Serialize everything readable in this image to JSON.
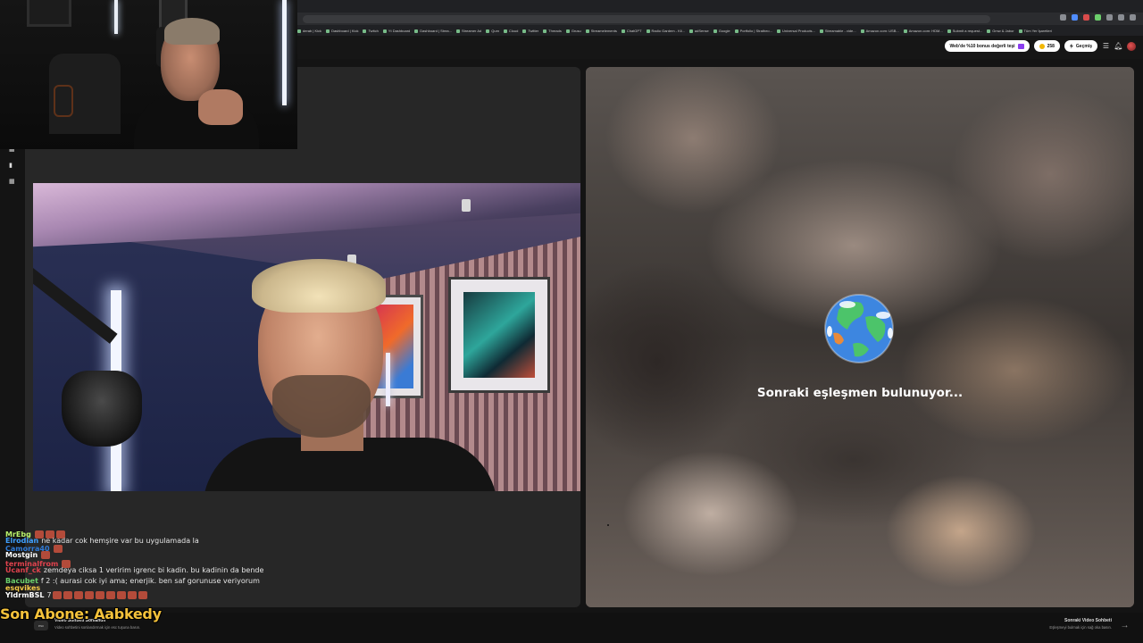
{
  "browser": {
    "bookmarks": [
      "derab | Kick",
      "Dashboard | Kick",
      "Twitch",
      "Yt Dashboard",
      "Dashboard | Strea...",
      "Streamer Ad",
      "Qum",
      "Cloud",
      "Twitter",
      "Threads",
      "Grusu",
      "Streamelements",
      "ChatGPT",
      "Radio Gardem - Kil...",
      "adSense",
      "Google",
      "Portfolio | Stratheo...",
      "Universal Products...",
      "Streamable - vide...",
      "Amazon.com: USB...",
      "Amazon.com: HDM...",
      "Submit a request...",
      "Gmw & Jabor",
      "Tüm Yer İşaretleri"
    ]
  },
  "header": {
    "bonus_label": "Web'de %10 bonus değerli teşi",
    "coins": "258",
    "history_label": "Geçmiş"
  },
  "right_panel": {
    "status_text": "Sonraki eşleşmen bulunuyor..."
  },
  "chat": {
    "lines": [
      {
        "user": "MrEbg",
        "user_color": "#b9f26b",
        "message": ""
      },
      {
        "user": "Elrodian",
        "user_color": "#3fa0ff",
        "message": "ne kadar cok hemşire var bu uygulamada la"
      },
      {
        "user": "Camorra40",
        "user_color": "#2f7ad6",
        "message": ""
      },
      {
        "user": "Mostgin",
        "user_color": "#ffffff",
        "message": ""
      },
      {
        "user": "terminalfrom",
        "user_color": "#e0424d",
        "message": ""
      },
      {
        "user": "Ucanf_ck",
        "user_color": "#e0424d",
        "message": "zemdeya ciksa 1 veririm igrenc bi kadin. bu kadinin da bende"
      },
      {
        "user": "Bacubet",
        "user_color": "#6ccf6c",
        "message": "f 2 :( aurasi cok iyi ama; enerjik. ben saf gorunuse veriyorum"
      },
      {
        "user": "esqvikes",
        "user_color": "#f3c948",
        "message": ""
      },
      {
        "user": "YldrmBSL",
        "user_color": "#ffffff",
        "message": "7"
      }
    ],
    "last_subscriber": "Son Abone: Aabkedy"
  },
  "bottom": {
    "esc_label": "esc",
    "end_title": "Video Sohbeti Sonlandır",
    "end_subtitle": "Video sohbetini sonlandırmak için esc tuşuna basın.",
    "next_title": "Sonraki Video Sohbeti",
    "next_subtitle": "Eşleşmeyi bulmak için sağ oka basın."
  },
  "colors": {
    "accent_yellow": "#f3c13a",
    "background": "#141414",
    "panel": "#272727"
  }
}
